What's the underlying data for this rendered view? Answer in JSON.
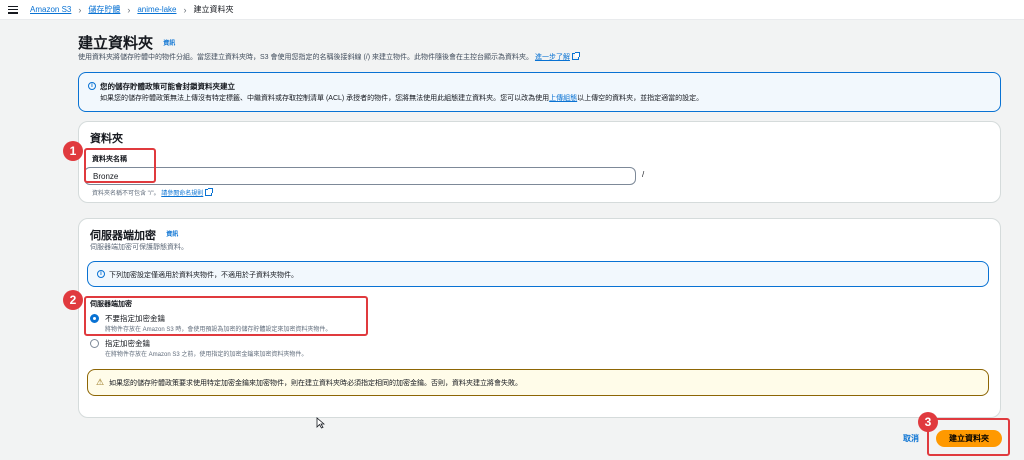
{
  "breadcrumb": {
    "items": [
      "Amazon S3",
      "儲存貯體",
      "anime-lake",
      "建立資料夾"
    ]
  },
  "header": {
    "title": "建立資料夾",
    "info_label": "資訊",
    "description": "使用資料夾將儲存貯體中的物件分組。當您建立資料夾時，S3 會使用您指定的名稱後接斜線 (/) 來建立物件。此物件隨後會在主控台顯示為資料夾。",
    "learn_more": "進一步了解"
  },
  "bucket_alert": {
    "title": "您的儲存貯體政策可能會封鎖資料夾建立",
    "body_before": "如果您的儲存貯體政策無法上傳沒有特定標籤、中繼資料或存取控制清單 (ACL) 承授者的物件，您將無法使用此組態建立資料夾。您可以改為使用",
    "body_link": "上傳組態",
    "body_after": "以上傳空的資料夾，並指定適當的設定。"
  },
  "folder_panel": {
    "title": "資料夾",
    "name_label": "資料夾名稱",
    "name_value": "Bronze",
    "suffix": "/",
    "hint_before": "資料夾名稱不可包含 \"/\"。",
    "hint_link": "請參閱命名規則"
  },
  "encryption_panel": {
    "title": "伺服器端加密",
    "info_label": "資訊",
    "description": "伺服器端加密可保護靜態資料。",
    "info_alert": "下列加密設定僅適用於資料夾物件，不適用於子資料夾物件。",
    "group_label": "伺服器端加密",
    "options": [
      {
        "label": "不要指定加密金鑰",
        "desc": "將物件存放在 Amazon S3 時，會使用預設為加密的儲存貯體設定來加密資料夾物件。",
        "checked": true
      },
      {
        "label": "指定加密金鑰",
        "desc": "在將物件存放在 Amazon S3 之前，使用指定的加密金鑰來加密資料夾物件。",
        "checked": false
      }
    ],
    "warning": "如果您的儲存貯體政策要求使用特定加密金鑰來加密物件，則在建立資料夾時必須指定相同的加密金鑰。否則，資料夾建立將會失敗。"
  },
  "footer": {
    "cancel_label": "取消",
    "create_label": "建立資料夾"
  },
  "annotations": [
    "1",
    "2",
    "3"
  ],
  "colors": {
    "link": "#0972d3",
    "primary_button": "#ff9900",
    "callout": "#e03a3e",
    "warning_border": "#8d6605"
  }
}
